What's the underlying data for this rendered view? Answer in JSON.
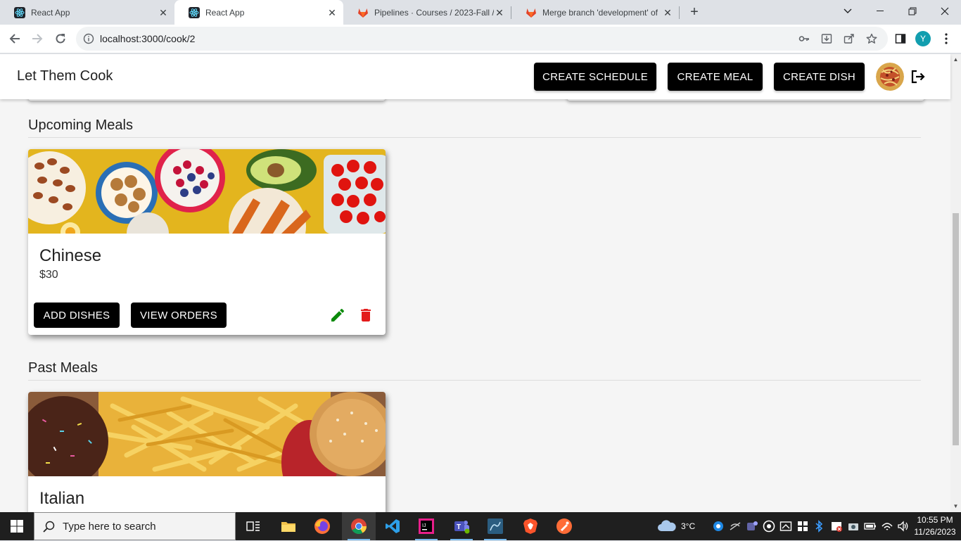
{
  "browser": {
    "tabs": [
      {
        "title": "React App",
        "icon": "react-icon"
      },
      {
        "title": "React App",
        "icon": "react-icon",
        "active": true
      },
      {
        "title": "Pipelines · Courses / 2023-Fall / C",
        "icon": "gitlab-icon"
      },
      {
        "title": "Merge branch 'development' of",
        "icon": "gitlab-icon"
      }
    ],
    "url": "localhost:3000/cook/2",
    "profile_initial": "Y"
  },
  "app": {
    "brand": "Let Them Cook",
    "nav": {
      "create_schedule": "CREATE SCHEDULE",
      "create_meal": "CREATE MEAL",
      "create_dish": "CREATE DISH"
    }
  },
  "sections": {
    "upcoming_title": "Upcoming Meals",
    "past_title": "Past Meals"
  },
  "upcoming_meals": [
    {
      "name": "Chinese",
      "price": "$30",
      "add_dishes": "ADD DISHES",
      "view_orders": "VIEW ORDERS"
    }
  ],
  "past_meals": [
    {
      "name": "Italian"
    }
  ],
  "colors": {
    "button_bg": "#000000",
    "edit_icon": "#0a8a0a",
    "delete_icon": "#e31b1b",
    "page_bg": "#f5f5f5"
  },
  "taskbar": {
    "search_placeholder": "Type here to search",
    "weather": "3°C",
    "time": "10:55 PM",
    "date": "11/26/2023"
  }
}
